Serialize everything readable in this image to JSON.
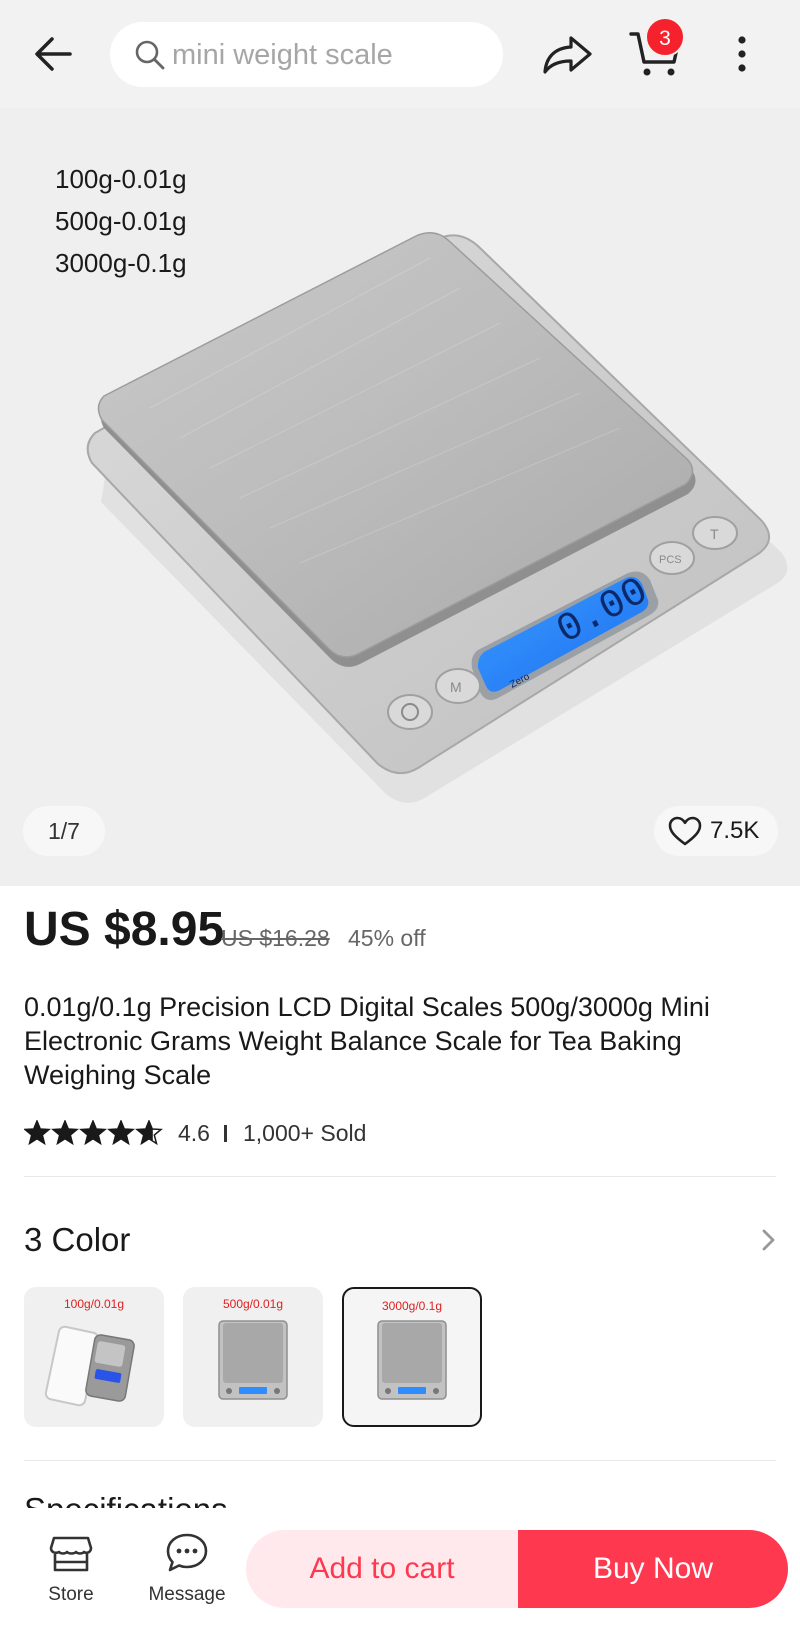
{
  "header": {
    "search_placeholder": "mini weight scale",
    "cart_count": "3"
  },
  "gallery": {
    "spec_lines": [
      "100g-0.01g",
      "500g-0.01g",
      "3000g-0.1g"
    ],
    "display_reading": "0.00",
    "display_zero_label": "Zero",
    "button_labels": [
      "PCS",
      "T",
      "M"
    ],
    "counter": "1/7",
    "wishlist_count": "7.5K"
  },
  "product": {
    "price": "US $8.95",
    "original_price": "US $16.28",
    "discount": "45% off",
    "title": "0.01g/0.1g Precision LCD Digital Scales 500g/3000g Mini Electronic Grams Weight Balance Scale for Tea Baking Weighing Scale",
    "rating": "4.6",
    "rating_stars_fraction": 0.92,
    "sold": "1,000+ Sold"
  },
  "variants": {
    "title": "3 Color",
    "options": [
      {
        "label": "100g/0.01g",
        "selected": false
      },
      {
        "label": "500g/0.01g",
        "selected": false
      },
      {
        "label": "3000g/0.1g",
        "selected": true
      }
    ]
  },
  "next_section": {
    "title": "Specifications"
  },
  "bottom_bar": {
    "store_label": "Store",
    "message_label": "Message",
    "add_to_cart_label": "Add to cart",
    "buy_now_label": "Buy Now"
  },
  "colors": {
    "accent": "#fd384f",
    "accent_light": "#ffe9ec",
    "badge": "#f5222d",
    "lcd_blue": "#1f7bff"
  }
}
